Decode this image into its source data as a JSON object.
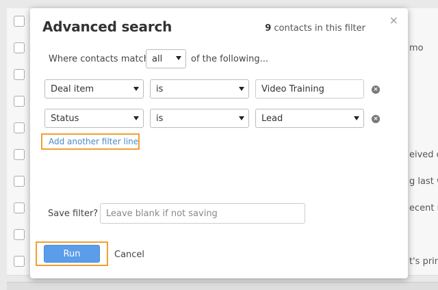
{
  "background": {
    "rows": [
      {
        "text": ""
      },
      {
        "text": "mo"
      },
      {
        "text": ""
      },
      {
        "text": ""
      },
      {
        "text": ""
      },
      {
        "text": "eived ou"
      },
      {
        "text": "g last w"
      },
      {
        "text": "ecent m"
      },
      {
        "text": ""
      },
      {
        "text": "t's prin"
      }
    ]
  },
  "modal": {
    "title": "Advanced search",
    "count_number": "9",
    "count_suffix": " contacts in this filter",
    "close_glyph": "×",
    "match_prefix": "Where contacts match",
    "match_value": "all",
    "match_suffix": "of the following...",
    "filters": [
      {
        "field": "Deal item",
        "operator": "is",
        "value": "Video Training",
        "value_type": "text"
      },
      {
        "field": "Status",
        "operator": "is",
        "value": "Lead",
        "value_type": "select"
      }
    ],
    "remove_glyph": "×",
    "add_filter_label": "Add another filter line",
    "save_label": "Save filter?",
    "save_placeholder": "Leave blank if not saving",
    "run_label": "Run",
    "cancel_label": "Cancel"
  },
  "colors": {
    "accent": "#5b9de8",
    "highlight": "#f0a030",
    "link": "#4a8ac8"
  }
}
